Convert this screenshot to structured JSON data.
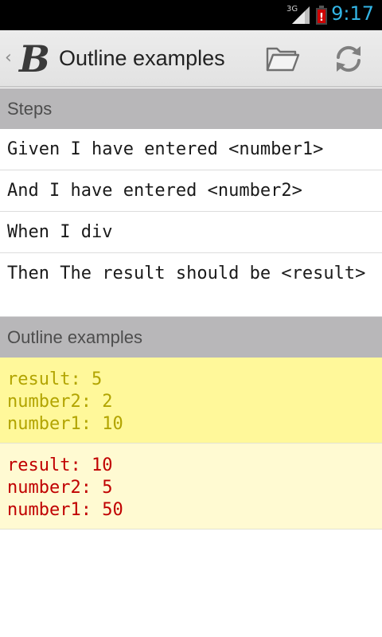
{
  "status_bar": {
    "network": "3G",
    "time": "9:17",
    "time_color": "#33b5e5",
    "battery_color": "#cc0000"
  },
  "action_bar": {
    "title": "Outline examples",
    "logo": "B",
    "up_icon": "chevron-left-icon",
    "actions": [
      {
        "name": "open",
        "icon": "folder-open-icon"
      },
      {
        "name": "refresh",
        "icon": "refresh-icon"
      }
    ]
  },
  "steps_section": {
    "header": "Steps",
    "items": [
      "Given I have entered <number1>",
      "And I have entered <number2>",
      "When I div",
      "Then The result should be <result>"
    ]
  },
  "examples_section": {
    "header": "Outline examples",
    "examples": [
      {
        "lines": [
          "result: 5",
          "number2: 2",
          "number1: 10"
        ],
        "background": "#fff89a",
        "text_color": "#b2a400"
      },
      {
        "lines": [
          "result: 10",
          "number2: 5",
          "number1: 50"
        ],
        "background": "#fffad2",
        "text_color": "#c00000"
      }
    ]
  }
}
